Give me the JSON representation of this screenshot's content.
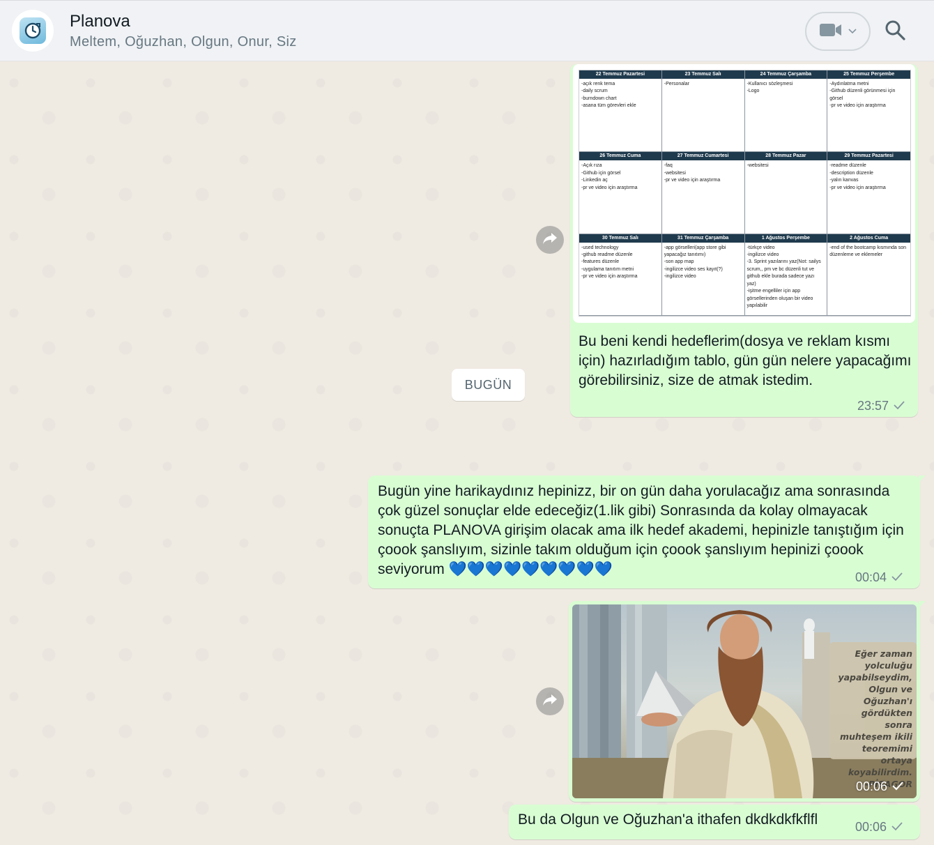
{
  "header": {
    "title": "Planova",
    "members": "Meltem, Oğuzhan, Olgun, Onur, Siz"
  },
  "schedule": [
    {
      "day": "22 Temmuz Pazartesi",
      "lines": "-açık renk tema\n-daily scrum\n-burndown chart\n-asana tüm görevleri ekle"
    },
    {
      "day": "23 Temmuz Salı",
      "lines": "-Personalar"
    },
    {
      "day": "24 Temmuz Çarşamba",
      "lines": "-Kullanıcı sözleşmesi\n-Logo"
    },
    {
      "day": "25 Temmuz Perşembe",
      "lines": "-Aydınlatma metni\n-Github düzenli görünmesi için görsel\n-pr ve video için araştırma"
    },
    {
      "day": "26 Temmuz Cuma",
      "lines": "-Açık rıza\n-Github için görsel\n-Linkedin aç\n-pr ve video için araştırma"
    },
    {
      "day": "27 Temmuz Cumartesi",
      "lines": "-faq\n-websitesi\n-pr ve video için araştırma"
    },
    {
      "day": "28 Temmuz Pazar",
      "lines": "-websitesi"
    },
    {
      "day": "29 Temmuz Pazartesi",
      "lines": "-readme düzenle\n-description düzenle\n-yalın kanvas\n-pr ve video için araştırma"
    },
    {
      "day": "30 Temmuz Salı",
      "lines": "-used technology\n-github readme düzenle\n-features düzenle\n-uygulama tanıtım metni\n-pr ve video için araştırma"
    },
    {
      "day": "31 Temmuz Çarşamba",
      "lines": "-app görselleri(app store gibi yapacağız tanıtımı)\n-son app map\n-ingilizce video ses kayıt(?)\n-ingilizce video"
    },
    {
      "day": "1 Ağustos Perşembe",
      "lines": "-türkçe video\n-ingilizce video\n-3. Sprint yazılarını yaz(Not: sailys scrum,, pm ve bc düzenli tut ve github ekle burada sadece yazı yaz)\n-işitme engelliler için app görsellerinden oluşan bir video yapılabilir"
    },
    {
      "day": "2 Ağustos Cuma",
      "lines": "-end of the bootcamp kısmında son düzenleme ve eklemeler"
    }
  ],
  "messages": [
    {
      "text": "Bu beni kendi hedeflerim(dosya ve reklam kısmı için) hazırladığım tablo, gün gün nelere yapacağımı görebilirsiniz, size de atmak istedim.",
      "time": "23:57"
    },
    {
      "text": "Bugün yine harikaydınız hepinizz, bir on gün daha yorulacağız ama sonrasında çok güzel sonuçlar elde edeceğiz(1.lik gibi) Sonrasında da kolay olmayacak sonuçta PLANOVA girişim olacak ama ilk hedef akademi, hepinizle tanıştığım için çoook şanslıyım, sizinle takım olduğum için çoook şanslıyım hepinizi çoook seviyorum 💙💙💙💙💙💙💙💙💙",
      "time": "00:04"
    },
    {
      "quote": "Eğer zaman\nyolculuğu\nyapabilseydim,\nOlgun ve Oğuzhan'ı\ngördükten sonra\nmuhteşem ikili\nteoremimi ortaya\nkoyabilirdim.\n-PİSAGOR",
      "time": "00:06"
    },
    {
      "text": "Bu da Olgun ve Oğuzhan'a ithafen dkdkdkfkflfl",
      "time": "00:06"
    }
  ],
  "date_divider": "BUGÜN",
  "colors": {
    "outgoing_bubble": "#d9fdd3",
    "chat_bg": "#efeae2",
    "header_bg": "#f0f2f5"
  }
}
